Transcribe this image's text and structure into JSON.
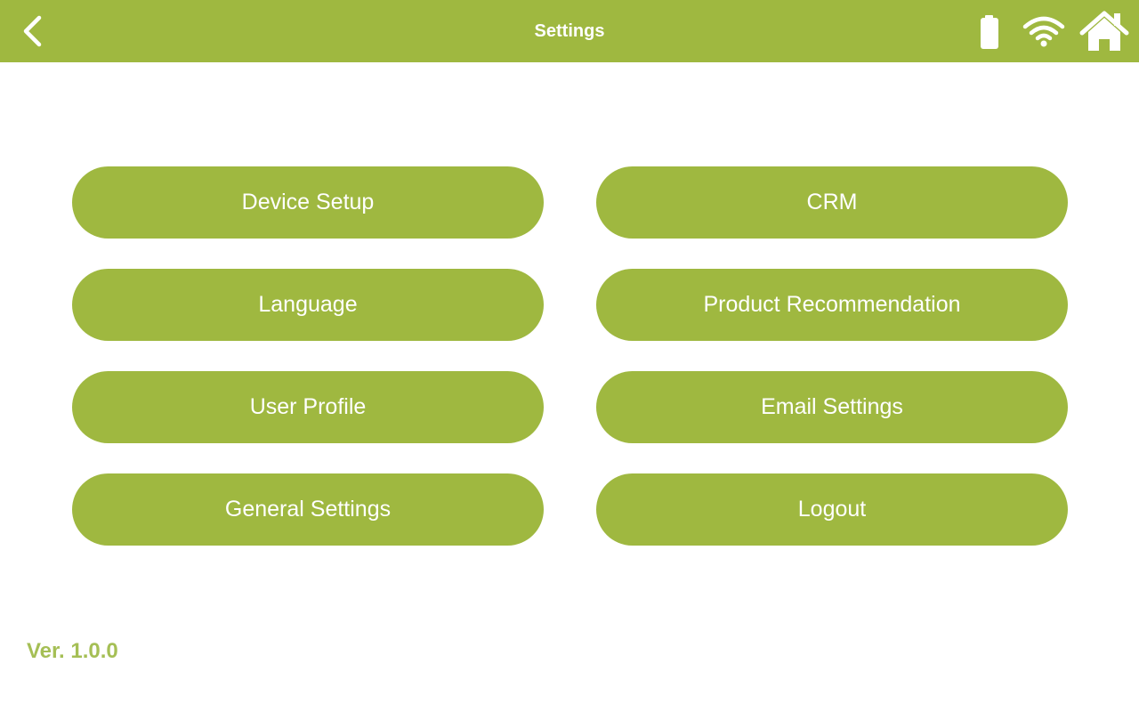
{
  "header": {
    "title": "Settings",
    "back_icon": "chevron-left-icon",
    "status_icons": [
      "battery-icon",
      "wifi-icon"
    ],
    "home_icon": "home-icon",
    "background_color": "#9fb840"
  },
  "menu": {
    "left": [
      {
        "label": "Device Setup"
      },
      {
        "label": "Language"
      },
      {
        "label": "User Profile"
      },
      {
        "label": "General Settings"
      }
    ],
    "right": [
      {
        "label": "CRM"
      },
      {
        "label": "Product Recommendation"
      },
      {
        "label": "Email Settings"
      },
      {
        "label": "Logout"
      }
    ]
  },
  "footer": {
    "version": "Ver. 1.0.0"
  },
  "colors": {
    "accent": "#9fb840",
    "version_text": "#a5bf55",
    "button_text": "#ffffff"
  }
}
